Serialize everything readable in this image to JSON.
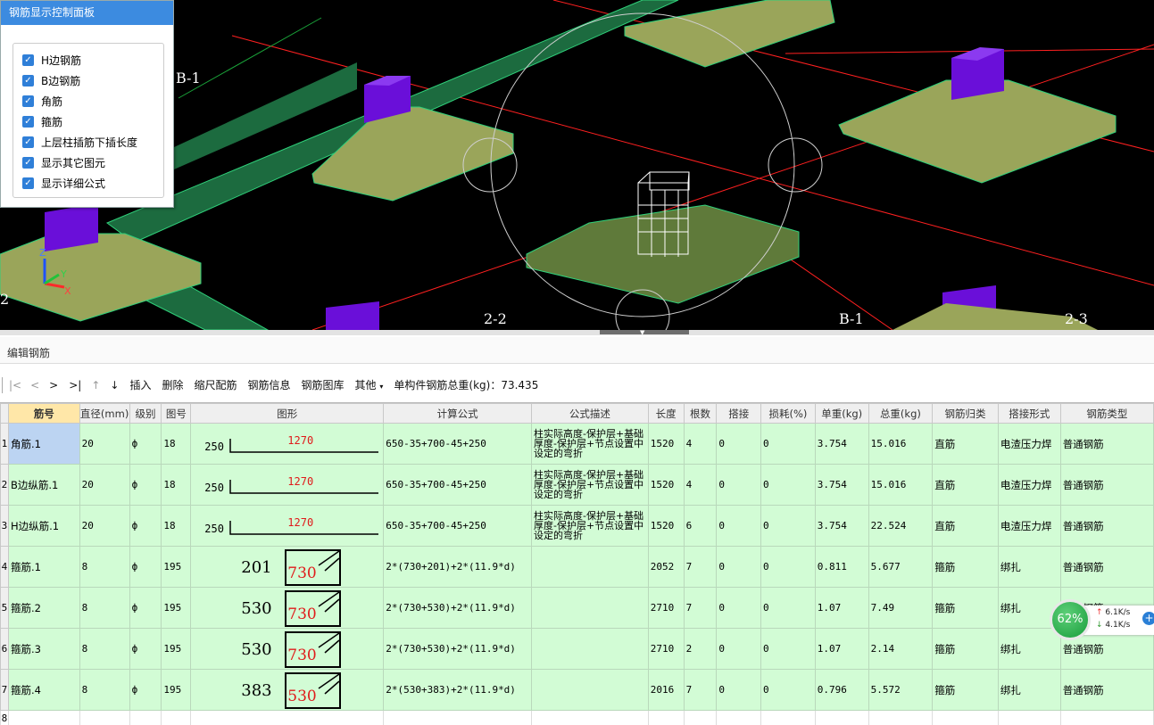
{
  "control_panel": {
    "title": "钢筋显示控制面板",
    "items": [
      {
        "label": "H边钢筋",
        "checked": true
      },
      {
        "label": "B边钢筋",
        "checked": true
      },
      {
        "label": "角筋",
        "checked": true
      },
      {
        "label": "箍筋",
        "checked": true
      },
      {
        "label": "上层柱插筋下插长度",
        "checked": true
      },
      {
        "label": "显示其它图元",
        "checked": true
      },
      {
        "label": "显示详细公式",
        "checked": true
      }
    ]
  },
  "viewport": {
    "axis_labels": [
      "B-1",
      "2-2",
      "B-1",
      "2-3",
      "2"
    ],
    "gizmo": {
      "z": "Z",
      "y": "Y",
      "x": "X"
    },
    "colors": {
      "background": "#000000",
      "footing": "#9aa55a",
      "column": "#6a0fd9",
      "slab": "#1f7a4a",
      "grid_line": "#ff2020"
    }
  },
  "editor": {
    "title": "编辑钢筋",
    "toolbar": {
      "first": "|<",
      "prev": "<",
      "next": ">",
      "last": ">|",
      "up": "↑",
      "down": "↓",
      "insert": "插入",
      "delete": "删除",
      "scale": "缩尺配筋",
      "info": "钢筋信息",
      "library": "钢筋图库",
      "other": "其他",
      "total": "单构件钢筋总重(kg)：73.435"
    },
    "columns": [
      "筋号",
      "直径(mm)",
      "级别",
      "图号",
      "图形",
      "计算公式",
      "公式描述",
      "长度",
      "根数",
      "搭接",
      "损耗(%)",
      "单重(kg)",
      "总重(kg)",
      "钢筋归类",
      "搭接形式",
      "钢筋类型"
    ],
    "rows": [
      {
        "no": "1",
        "name": "角筋.1",
        "dia": "20",
        "grade": "ф",
        "fig": "18",
        "s_left": "250",
        "s_main": "1270",
        "formula": "650-35+700-45+250",
        "desc": "柱实际高度-保护层+基础厚度-保护层+节点设置中设定的弯折",
        "len": "1520",
        "count": "4",
        "lap": "0",
        "loss": "0",
        "unit": "3.754",
        "total": "15.016",
        "cat": "直筋",
        "lap_type": "电渣压力焊",
        "type": "普通钢筋"
      },
      {
        "no": "2",
        "name": "B边纵筋.1",
        "dia": "20",
        "grade": "ф",
        "fig": "18",
        "s_left": "250",
        "s_main": "1270",
        "formula": "650-35+700-45+250",
        "desc": "柱实际高度-保护层+基础厚度-保护层+节点设置中设定的弯折",
        "len": "1520",
        "count": "4",
        "lap": "0",
        "loss": "0",
        "unit": "3.754",
        "total": "15.016",
        "cat": "直筋",
        "lap_type": "电渣压力焊",
        "type": "普通钢筋"
      },
      {
        "no": "3",
        "name": "H边纵筋.1",
        "dia": "20",
        "grade": "ф",
        "fig": "18",
        "s_left": "250",
        "s_main": "1270",
        "formula": "650-35+700-45+250",
        "desc": "柱实际高度-保护层+基础厚度-保护层+节点设置中设定的弯折",
        "len": "1520",
        "count": "6",
        "lap": "0",
        "loss": "0",
        "unit": "3.754",
        "total": "22.524",
        "cat": "直筋",
        "lap_type": "电渣压力焊",
        "type": "普通钢筋"
      },
      {
        "no": "4",
        "name": "箍筋.1",
        "dia": "8",
        "grade": "ф",
        "fig": "195",
        "s_left": "201",
        "s_main": "730",
        "formula": "2*(730+201)+2*(11.9*d)",
        "desc": "",
        "len": "2052",
        "count": "7",
        "lap": "0",
        "loss": "0",
        "unit": "0.811",
        "total": "5.677",
        "cat": "箍筋",
        "lap_type": "绑扎",
        "type": "普通钢筋"
      },
      {
        "no": "5",
        "name": "箍筋.2",
        "dia": "8",
        "grade": "ф",
        "fig": "195",
        "s_left": "530",
        "s_main": "730",
        "formula": "2*(730+530)+2*(11.9*d)",
        "desc": "",
        "len": "2710",
        "count": "7",
        "lap": "0",
        "loss": "0",
        "unit": "1.07",
        "total": "7.49",
        "cat": "箍筋",
        "lap_type": "绑扎",
        "type": "普通钢筋"
      },
      {
        "no": "6",
        "name": "箍筋.3",
        "dia": "8",
        "grade": "ф",
        "fig": "195",
        "s_left": "530",
        "s_main": "730",
        "formula": "2*(730+530)+2*(11.9*d)",
        "desc": "",
        "len": "2710",
        "count": "2",
        "lap": "0",
        "loss": "0",
        "unit": "1.07",
        "total": "2.14",
        "cat": "箍筋",
        "lap_type": "绑扎",
        "type": "普通钢筋"
      },
      {
        "no": "7",
        "name": "箍筋.4",
        "dia": "8",
        "grade": "ф",
        "fig": "195",
        "s_left": "383",
        "s_main": "530",
        "formula": "2*(530+383)+2*(11.9*d)",
        "desc": "",
        "len": "2016",
        "count": "7",
        "lap": "0",
        "loss": "0",
        "unit": "0.796",
        "total": "5.572",
        "cat": "箍筋",
        "lap_type": "绑扎",
        "type": "普通钢筋"
      }
    ],
    "empty_row_no": "8"
  },
  "net_widget": {
    "percent": "62%",
    "up": "6.1K/s",
    "down": "4.1K/s"
  }
}
